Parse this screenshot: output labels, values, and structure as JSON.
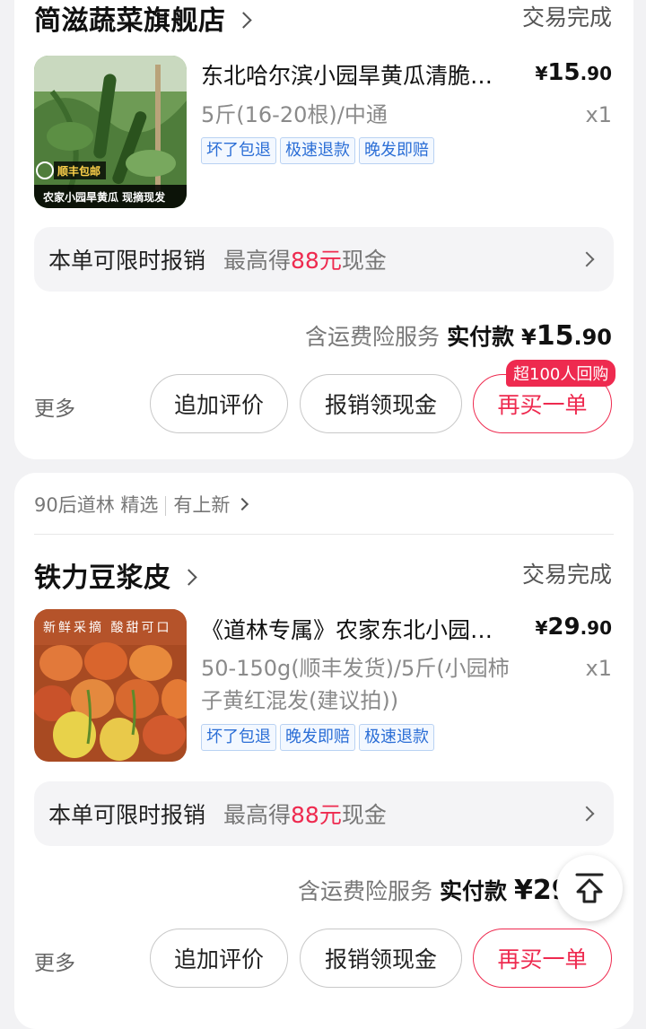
{
  "orders": [
    {
      "store": "简滋蔬菜旗舰店",
      "status": "交易完成",
      "item_title": "东北哈尔滨小园旱黄瓜清脆…",
      "price_currency": "¥",
      "price_int": "15",
      "price_dec": ".90",
      "spec": "5斤(16-20根)/中通",
      "qty": "x1",
      "tags": [
        "坏了包退",
        "极速退款",
        "晚发即赔"
      ],
      "thumb_text_top": "顺丰包邮",
      "thumb_text_bottom": "农家小园旱黄瓜 现摘现发",
      "rebate_title": "本单可限时报销",
      "rebate_prefix": "最高得",
      "rebate_amount": "88元",
      "rebate_suffix": "现金",
      "insurance": "含运费险服务",
      "paid_label": "实付款",
      "paid_currency": "¥",
      "paid_int": "15",
      "paid_dec": ".90",
      "more": "更多",
      "btn_review": "追加评价",
      "btn_rebate": "报销领现金",
      "btn_rebuy": "再买一单",
      "rebuy_badge": "超100人回购"
    },
    {
      "shop_source": "90后道林 精选",
      "shop_new": "有上新",
      "store": "铁力豆浆皮",
      "status": "交易完成",
      "item_title": "《道林专属》农家东北小园…",
      "price_currency": "¥",
      "price_int": "29",
      "price_dec": ".90",
      "spec_line1": "50-150g(顺丰发货)/5斤(小园柿",
      "spec_line2": "子黄红混发(建议拍))",
      "qty": "x1",
      "tags": [
        "坏了包退",
        "晚发即赔",
        "极速退款"
      ],
      "thumb_text_top": "新鲜采摘 酸甜可口",
      "rebate_title": "本单可限时报销",
      "rebate_prefix": "最高得",
      "rebate_amount": "88元",
      "rebate_suffix": "现金",
      "insurance": "含运费险服务",
      "paid_label": "实付款",
      "paid_partial": "¥29",
      "more": "更多",
      "btn_review": "追加评价",
      "btn_rebate": "报销领现金",
      "btn_rebuy": "再买一单"
    }
  ],
  "fab_icon": "back-to-top-icon",
  "colors": {
    "accent": "#ee2a4f",
    "tag_blue": "#2b6ed6"
  }
}
